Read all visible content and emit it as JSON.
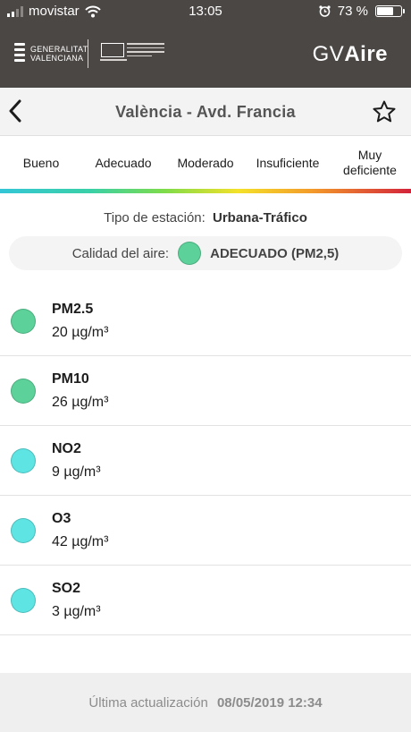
{
  "status_bar": {
    "carrier": "movistar",
    "time": "13:05",
    "battery": "73 %",
    "battery_level": 0.73
  },
  "header": {
    "brand_prefix": "GV",
    "brand_suffix": "Aire",
    "logo_line1": "GENERALITAT",
    "logo_line2": "VALENCIANA"
  },
  "nav": {
    "title": "València - Avd. Francia",
    "back_icon": "chevron-left-icon",
    "favorite_icon": "star-outline-icon"
  },
  "scale": {
    "levels": [
      "Bueno",
      "Adecuado",
      "Moderado",
      "Insuficiente",
      "Muy deficiente"
    ]
  },
  "station": {
    "type_label": "Tipo de estación:",
    "type_value": "Urbana-Tráfico"
  },
  "air_quality": {
    "label": "Calidad del aire:",
    "value": "ADECUADO (PM2,5)",
    "color": "#5cd29a"
  },
  "pollutants": [
    {
      "name": "PM2.5",
      "value": "20 µg/m³",
      "color": "#5cd29a"
    },
    {
      "name": "PM10",
      "value": "26 µg/m³",
      "color": "#5cd29a"
    },
    {
      "name": "NO2",
      "value": "9 µg/m³",
      "color": "#5ee5e3"
    },
    {
      "name": "O3",
      "value": "42 µg/m³",
      "color": "#5ee5e3"
    },
    {
      "name": "SO2",
      "value": "3 µg/m³",
      "color": "#5ee5e3"
    }
  ],
  "footer": {
    "label": "Última actualización",
    "timestamp": "08/05/2019 12:34"
  }
}
